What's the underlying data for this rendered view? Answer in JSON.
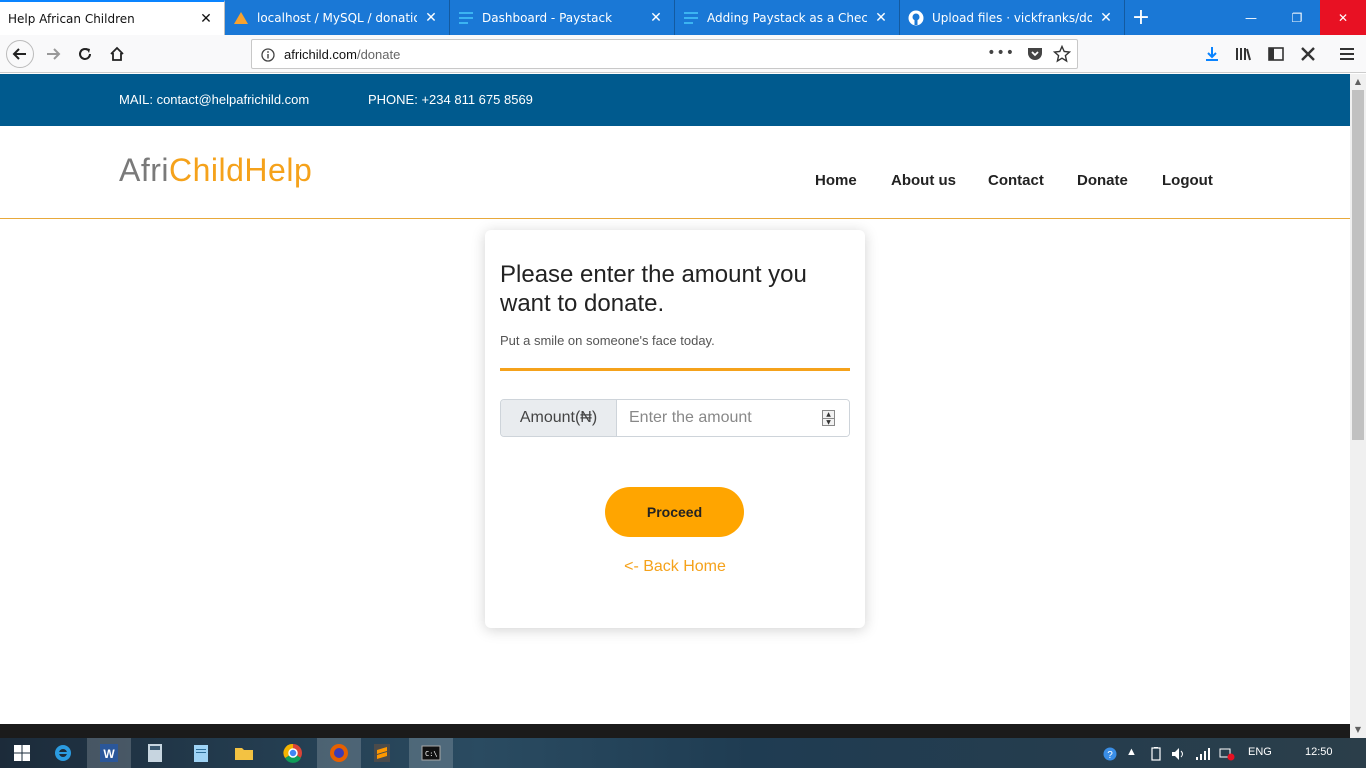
{
  "browser": {
    "tabs": [
      {
        "title": "Help African Children",
        "active": true
      },
      {
        "title": "localhost / MySQL / donation |",
        "active": false
      },
      {
        "title": "Dashboard - Paystack",
        "active": false
      },
      {
        "title": "Adding Paystack as a Checkout",
        "active": false
      },
      {
        "title": "Upload files · vickfranks/donati",
        "active": false
      }
    ],
    "url_host": "africhild.com",
    "url_path": "/donate"
  },
  "topbar": {
    "mail": "MAIL: contact@helpafrichild.com",
    "phone": "PHONE: +234 811 675 8569"
  },
  "header": {
    "logo_part1": "Afri",
    "logo_part2": "ChildHelp",
    "menu": [
      "Home",
      "About us",
      "Contact",
      "Donate",
      "Logout"
    ]
  },
  "card": {
    "heading": "Please enter the amount you want to donate.",
    "subtitle": "Put a smile on someone's face today.",
    "amount_label": "Amount(₦)",
    "amount_placeholder": "Enter the amount",
    "proceed_label": "Proceed",
    "back_link": "<- Back Home"
  },
  "taskbar": {
    "lang": "ENG",
    "time": "12:50"
  },
  "colors": {
    "accent": "#f5a21b",
    "button": "#ffa500",
    "topbar": "#005a8e",
    "tabstrip": "#1a78d6"
  }
}
